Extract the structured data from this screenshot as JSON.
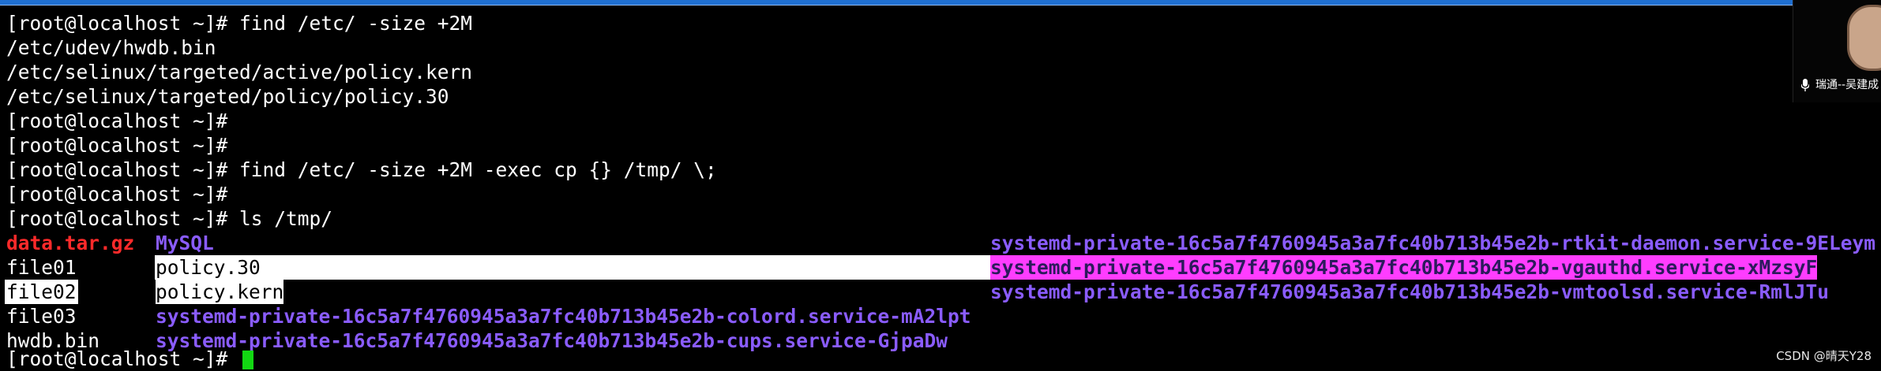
{
  "terminal": {
    "lines": [
      "[root@localhost ~]# find /etc/ -size +2M",
      "/etc/udev/hwdb.bin",
      "/etc/selinux/targeted/active/policy.kern",
      "/etc/selinux/targeted/policy/policy.30",
      "[root@localhost ~]#",
      "[root@localhost ~]#",
      "[root@localhost ~]# find /etc/ -size +2M -exec cp {} /tmp/ \\;",
      "[root@localhost ~]#",
      "[root@localhost ~]# ls /tmp/"
    ],
    "ls_output": {
      "col1": [
        "data.tar.gz",
        "file01",
        "file02",
        "file03",
        "hwdb.bin"
      ],
      "col2": [
        "MySQL",
        "policy.30",
        "policy.kern",
        "systemd-private-16c5a7f4760945a3a7fc40b713b45e2b-colord.service-mA2lpt",
        "systemd-private-16c5a7f4760945a3a7fc40b713b45e2b-cups.service-GjpaDw"
      ],
      "col3": [
        "systemd-private-16c5a7f4760945a3a7fc40b713b45e2b-rtkit-daemon.service-9ELeym",
        "systemd-private-16c5a7f4760945a3a7fc40b713b45e2b-vgauthd.service-xMzsyF",
        "systemd-private-16c5a7f4760945a3a7fc40b713b45e2b-vmtoolsd.service-RmlJTu"
      ]
    },
    "prompt": "[root@localhost ~]# "
  },
  "video_tile": {
    "label": "瑞通--吴建成",
    "mic_icon": "microphone-icon"
  },
  "watermark": "CSDN @晴天Y28",
  "colors": {
    "background": "#000000",
    "text": "#ffffff",
    "archive_red": "#ff2a2a",
    "directory_purple": "#8a5cff",
    "highlight_magenta": "#ff3dff",
    "cursor_green": "#12d812",
    "top_bar_blue": "#1f6fd1"
  }
}
